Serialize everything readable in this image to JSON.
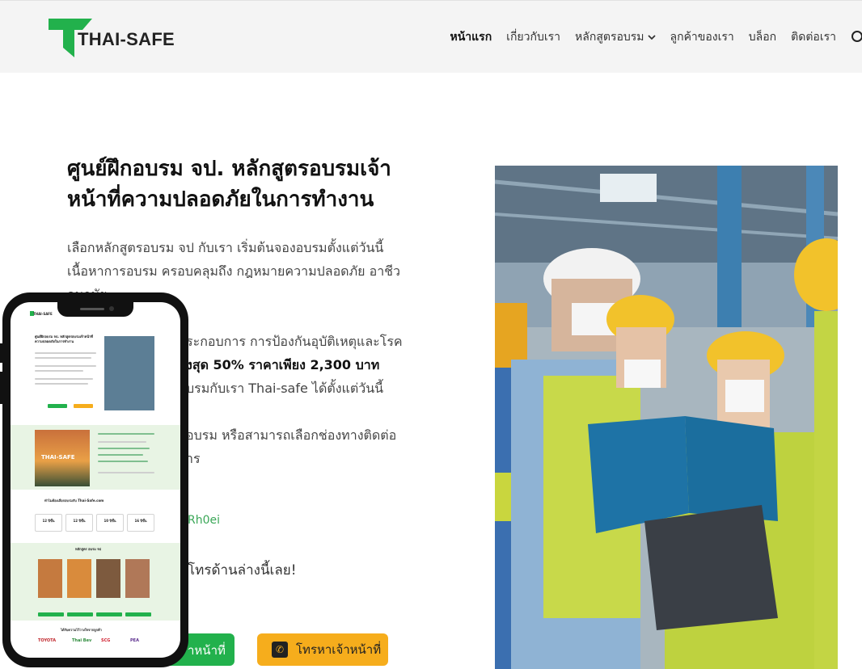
{
  "header": {
    "logo_text": "THAI-SAFE",
    "brand_green": "#22b14c",
    "nav": [
      {
        "label": "หน้าแรก",
        "active": true
      },
      {
        "label": "เกี่ยวกับเรา",
        "active": false
      },
      {
        "label": "หลักสูตรอบรม",
        "active": false,
        "dropdown": true
      },
      {
        "label": "ลูกค้าของเรา",
        "active": false
      },
      {
        "label": "บล็อก",
        "active": false
      },
      {
        "label": "ติดต่อเรา",
        "active": false
      }
    ],
    "search_icon": "search-icon",
    "dropdown_icon": "chevron-down-icon"
  },
  "hero": {
    "title_line1": "ศูนย์ฝึกอบรม จป. หลักสูตรอบรมเจ้า",
    "title_line2": "หน้าที่ความปลอดภัยในการทำงาน",
    "p1_line1": "เลือกหลักสูตรอบรม จป กับเรา เริ่มต้นจองอบรมตั้งแต่วันนี้",
    "p1_line2": "เนื้อหาการอบรม ครอบคลุมถึง กฎหมายความปลอดภัย อาชีว",
    "p1_line3": "อนามัย",
    "p2_line1": "ระกอบการ การป้องกันอุบัติเหตุและโรค",
    "p2_line2": "งสุด 50% ราคาเพียง 2,300 บาท",
    "p2_line3": "บรมกับเรา Thai-safe ได้ตั้งแต่วันนี้",
    "p3_line1": "อบรม หรือสามารถเลือกช่องทางติดต่อ",
    "p3_line2": "าร",
    "link_fragment": "Rh0ei",
    "cta_fragment": "โทรด้านล่างนี้เลย!"
  },
  "buttons": {
    "green_label": "าหน้าที่",
    "orange_label": "โทรหาเจ้าหน้าที่",
    "orange_color": "#f6ad1c",
    "phone_icon": "phone-icon"
  },
  "mockup": {
    "logo_text": "THAI-SAFE",
    "title": "ศูนย์ฝึกอบรม จป. หลักสูตรอบรมเจ้าหน้าที่ความปลอดภัยในการทำงาน",
    "banner_text": "THAI-SAFE",
    "section_title": "ทำไมต้องเลือกอบรมกับ Thai-Safe.com",
    "stats": [
      "12 ปีขึ้น",
      "12 ปีขึ้น",
      "10 ปีขึ้น",
      "16 ปีขึ้น"
    ],
    "course_title": "หลักสูตร อบรม จป",
    "clients_title": "ได้รับความไว้วางใจจากลูกค้า",
    "clients": [
      "TOYOTA",
      "Thai Bev",
      "SCG",
      "PEA"
    ]
  }
}
